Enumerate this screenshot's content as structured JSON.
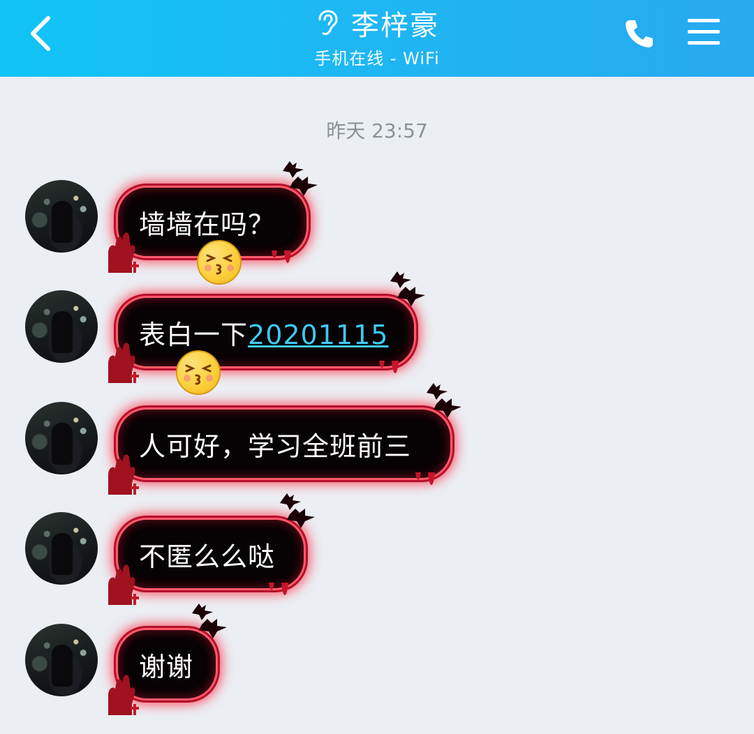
{
  "header": {
    "contact_name": "李梓豪",
    "status": "手机在线 - WiFi",
    "colors": {
      "start": "#11c4f6",
      "end": "#27a9f0"
    },
    "icons": [
      "back-icon",
      "ear-icon",
      "phone-icon",
      "menu-icon"
    ]
  },
  "chat": {
    "timestamp": "昨天 23:57",
    "messages": [
      {
        "text": "墙墙在吗？",
        "emoji": "kiss-face"
      },
      {
        "text": "表白一下",
        "link": "20201115",
        "emoji": "kiss-face"
      },
      {
        "text": "人可好，学习全班前三"
      },
      {
        "text": "不匿么么哒"
      },
      {
        "text": "谢谢"
      }
    ]
  },
  "theme": {
    "bubble_fill": "#070204",
    "bubble_glow": "#ff3a4a",
    "link_color": "#3fc9f3",
    "background": "#ebeef3"
  }
}
